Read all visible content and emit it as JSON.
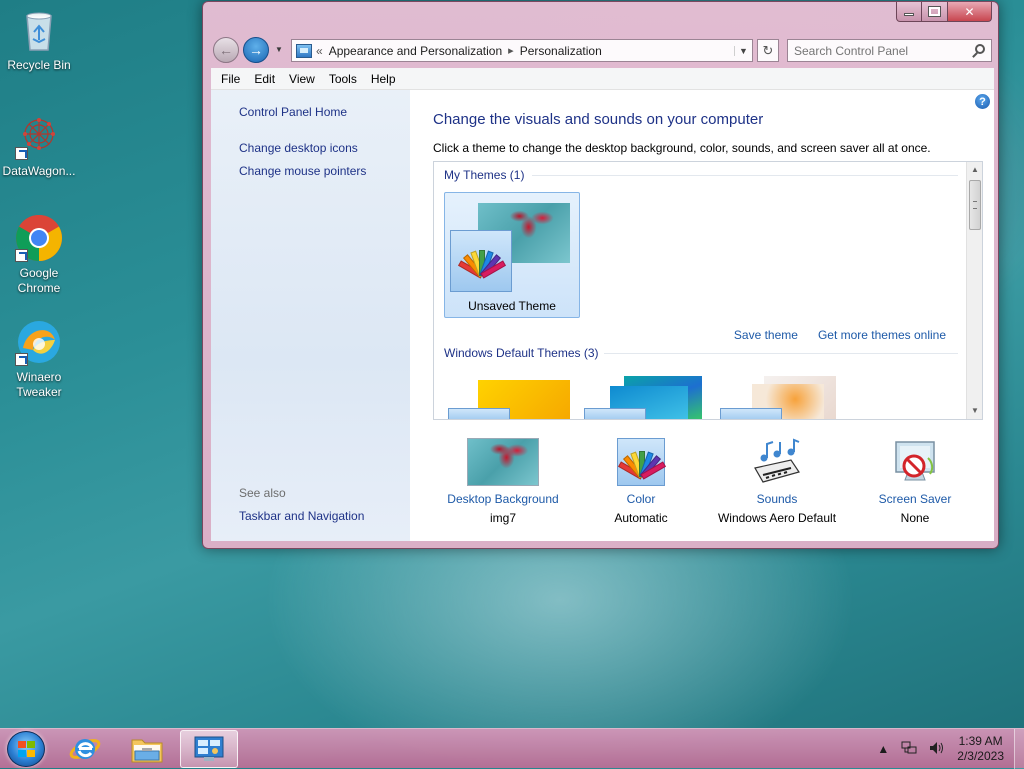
{
  "desktop": {
    "icons": [
      {
        "label": "Recycle Bin",
        "icon": "recycle-bin-icon"
      },
      {
        "label": "DataWagon...",
        "icon": "datawagon-icon"
      },
      {
        "label": "Google Chrome",
        "icon": "chrome-icon"
      },
      {
        "label": "Winaero Tweaker",
        "icon": "winaero-tweaker-icon"
      }
    ]
  },
  "window": {
    "breadcrumb": {
      "prefix": "«",
      "items": [
        "Appearance and Personalization",
        "Personalization"
      ],
      "separator": "▸"
    },
    "search": {
      "placeholder": "Search Control Panel"
    },
    "menu": [
      "File",
      "Edit",
      "View",
      "Tools",
      "Help"
    ],
    "left_pane": {
      "home": "Control Panel Home",
      "links": [
        "Change desktop icons",
        "Change mouse pointers"
      ],
      "see_also_title": "See also",
      "see_also_links": [
        "Taskbar and Navigation"
      ]
    },
    "main": {
      "title": "Change the visuals and sounds on your computer",
      "description": "Click a theme to change the desktop background, color, sounds, and screen saver all at once.",
      "my_themes_title": "My Themes (1)",
      "my_theme_name": "Unsaved Theme",
      "save_theme": "Save theme",
      "get_more_themes": "Get more themes online",
      "default_themes_title": "Windows Default Themes (3)"
    },
    "bottom": [
      {
        "label": "Desktop Background",
        "value": "img7",
        "icon": "desktop-background-icon"
      },
      {
        "label": "Color",
        "value": "Automatic",
        "icon": "color-palette-icon"
      },
      {
        "label": "Sounds",
        "value": "Windows Aero Default",
        "icon": "sounds-icon"
      },
      {
        "label": "Screen Saver",
        "value": "None",
        "icon": "screen-saver-icon"
      }
    ]
  },
  "taskbar": {
    "buttons": [
      "start-button",
      "internet-explorer-icon",
      "file-explorer-icon",
      "control-panel-icon"
    ],
    "tray": {
      "time": "1:39 AM",
      "date": "2/3/2023"
    }
  },
  "colors": {
    "link": "#1e3287",
    "accent_link": "#1e5aa8",
    "window_frame": "#e3b7cf",
    "taskbar": "#cd88ad"
  }
}
